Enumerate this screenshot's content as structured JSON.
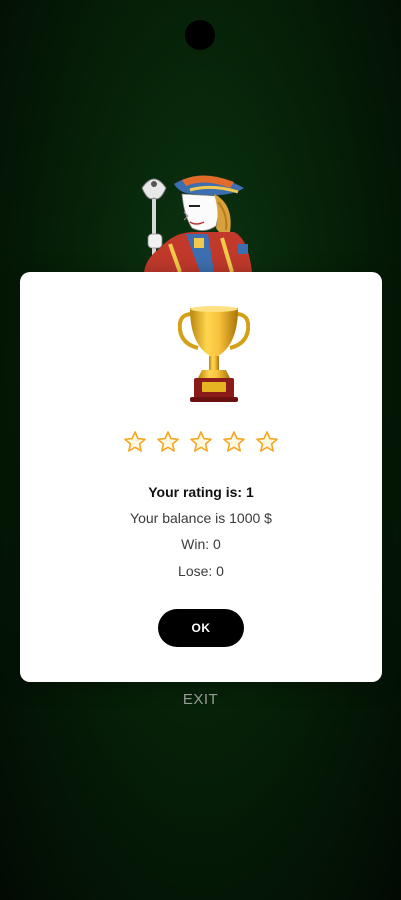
{
  "background": {
    "color": "#062208",
    "card_art_icon": "jack-of-spades-icon"
  },
  "dialog": {
    "trophy_icon": "trophy-icon",
    "stars": {
      "icon": "star-outline-icon",
      "count": 5,
      "color": "#f5a623"
    },
    "rating_text": "Your rating is: 1",
    "balance_text": "Your balance is 1000 $",
    "win_text": "Win: 0",
    "lose_text": "Lose: 0",
    "ok_label": "OK"
  },
  "exit_label": "EXIT",
  "colors": {
    "dialog_background": "#ffffff",
    "button_background": "#000000",
    "button_text": "#ffffff",
    "exit_text": "#9a9a9a"
  }
}
